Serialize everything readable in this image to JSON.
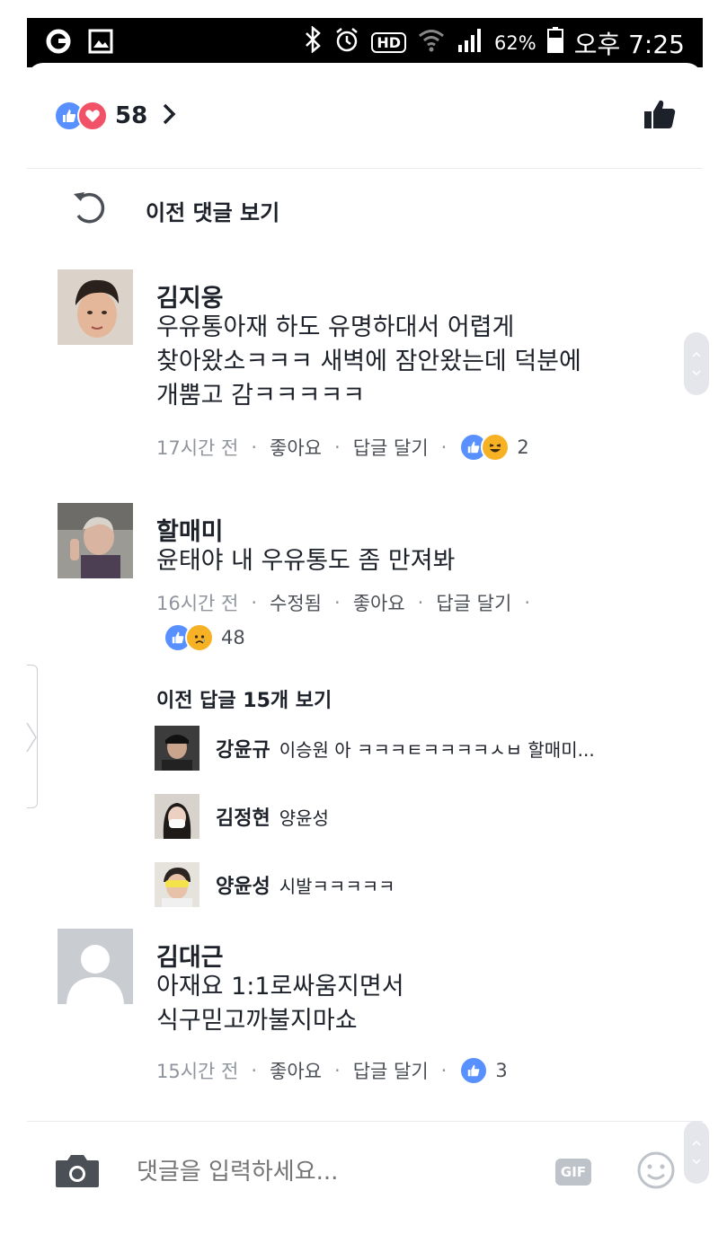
{
  "status_bar": {
    "battery": "62%",
    "time": "오후 7:25",
    "hd_label": "HD"
  },
  "reactions": {
    "count": "58",
    "like_color": "#5890ff",
    "love_color": "#f25268"
  },
  "prev_comments_label": "이전 댓글 보기",
  "comments": [
    {
      "name": "김지웅",
      "lines": [
        "우유통아재 하도 유명하대서 어렵게",
        "찾아왔소ㅋㅋㅋ 새벽에 잠안왔는데 덕분에",
        "개뿜고 감ㅋㅋㅋㅋㅋ"
      ],
      "time": "17시간 전",
      "like_label": "좋아요",
      "reply_label": "답글 달기",
      "reaction_count": "2"
    },
    {
      "name": "할매미",
      "lines": [
        "윤태야 내 우유통도 좀 만져봐"
      ],
      "time": "16시간 전",
      "edited_label": "수정됨",
      "like_label": "좋아요",
      "reply_label": "답글 달기",
      "reaction_count": "48",
      "prev_replies_label": "이전 답글 15개 보기",
      "replies": [
        {
          "name": "강윤규",
          "text": "이승원 아 ㅋㅋㅋㅌㅋㅋㅋㅋㅅㅂ 할매미..."
        },
        {
          "name": "김정현",
          "text": "양윤성"
        },
        {
          "name": "양윤성",
          "text": "시발ㅋㅋㅋㅋㅋ"
        }
      ]
    },
    {
      "name": "김대근",
      "lines": [
        "아재요 1:1로싸움지면서",
        "식구믿고까불지마쇼"
      ],
      "time": "15시간 전",
      "like_label": "좋아요",
      "reply_label": "답글 달기",
      "reaction_count": "3"
    }
  ],
  "input": {
    "placeholder": "댓글을 입력하세요...",
    "gif_label": "GIF"
  },
  "separator": "·"
}
